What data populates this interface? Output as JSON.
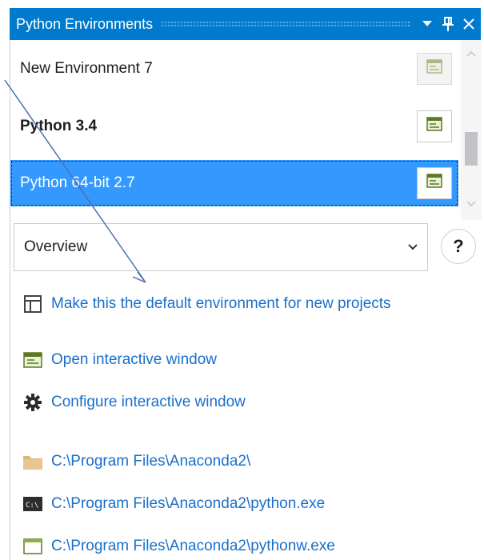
{
  "window": {
    "title": "Python Environments"
  },
  "environments": [
    {
      "name": "New Environment 7",
      "state": "normal"
    },
    {
      "name": "Python 3.4",
      "state": "default"
    },
    {
      "name": "Python 64-bit 2.7",
      "state": "selected"
    }
  ],
  "view_select": {
    "selected": "Overview",
    "help_label": "?"
  },
  "actions": {
    "make_default": "Make this the default environment for new projects",
    "open_interactive": "Open interactive window",
    "configure_interactive": "Configure interactive window"
  },
  "paths": {
    "prefix": "C:\\Program Files\\Anaconda2\\",
    "interpreter": "C:\\Program Files\\Anaconda2\\python.exe",
    "windowed_interpreter": "C:\\Program Files\\Anaconda2\\pythonw.exe"
  },
  "colors": {
    "titlebar": "#007acc",
    "selection": "#3399ff",
    "link": "#1a6fc9",
    "annotation_arrow": "#4a6fae"
  },
  "icons": {
    "dropdown_arrow": "dropdown-arrow-icon",
    "pin": "pin-icon",
    "close": "close-icon",
    "interactive_window": "interactive-window-icon",
    "layout": "layout-icon",
    "gear": "gear-icon",
    "folder": "folder-icon",
    "console": "console-icon",
    "window": "window-icon"
  }
}
